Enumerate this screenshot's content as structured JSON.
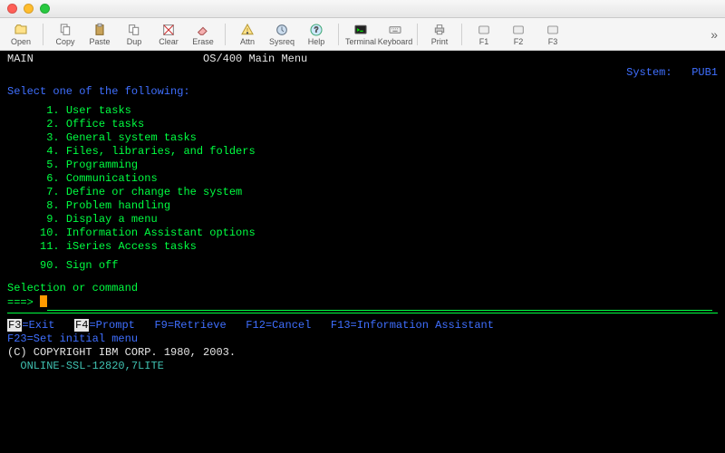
{
  "toolbar": {
    "buttons": [
      {
        "label": "Open",
        "name": "open-button",
        "icon": "open-icon"
      },
      {
        "label": "Copy",
        "name": "copy-button",
        "icon": "copy-icon"
      },
      {
        "label": "Paste",
        "name": "paste-button",
        "icon": "paste-icon"
      },
      {
        "label": "Dup",
        "name": "dup-button",
        "icon": "dup-icon"
      },
      {
        "label": "Clear",
        "name": "clear-button",
        "icon": "clear-icon"
      },
      {
        "label": "Erase",
        "name": "erase-button",
        "icon": "erase-icon"
      },
      {
        "label": "Attn",
        "name": "attn-button",
        "icon": "attn-icon"
      },
      {
        "label": "Sysreq",
        "name": "sysreq-button",
        "icon": "sysreq-icon"
      },
      {
        "label": "Help",
        "name": "help-button",
        "icon": "help-icon"
      },
      {
        "label": "Terminal",
        "name": "terminal-button",
        "icon": "terminal-icon"
      },
      {
        "label": "Keyboard",
        "name": "keyboard-button",
        "icon": "keyboard-icon"
      },
      {
        "label": "Print",
        "name": "print-button",
        "icon": "print-icon"
      },
      {
        "label": "F1",
        "name": "f1-button",
        "icon": "fkey-icon"
      },
      {
        "label": "F2",
        "name": "f2-button",
        "icon": "fkey-icon"
      },
      {
        "label": "F3",
        "name": "f3-button",
        "icon": "fkey-icon"
      }
    ],
    "overflow": "»"
  },
  "screen": {
    "menu_id": "MAIN",
    "title": "OS/400 Main Menu",
    "system_label": "System:",
    "system_name": "PUB1",
    "prompt": "Select one of the following:",
    "options": [
      {
        "num": "1.",
        "text": "User tasks"
      },
      {
        "num": "2.",
        "text": "Office tasks"
      },
      {
        "num": "3.",
        "text": "General system tasks"
      },
      {
        "num": "4.",
        "text": "Files, libraries, and folders"
      },
      {
        "num": "5.",
        "text": "Programming"
      },
      {
        "num": "6.",
        "text": "Communications"
      },
      {
        "num": "7.",
        "text": "Define or change the system"
      },
      {
        "num": "8.",
        "text": "Problem handling"
      },
      {
        "num": "9.",
        "text": "Display a menu"
      },
      {
        "num": "10.",
        "text": "Information Assistant options"
      },
      {
        "num": "11.",
        "text": "iSeries Access tasks"
      }
    ],
    "signoff": {
      "num": "90.",
      "text": "Sign off"
    },
    "cmd_label": "Selection or command",
    "cmd_prompt": "===>",
    "fkeys": [
      {
        "key": "F3",
        "label": "=Exit"
      },
      {
        "key": "F4",
        "label": "=Prompt"
      },
      {
        "key": "F9",
        "label": "=Retrieve"
      },
      {
        "key": "F12",
        "label": "=Cancel"
      },
      {
        "key": "F13",
        "label": "=Information Assistant"
      },
      {
        "key": "F23",
        "label": "=Set initial menu"
      }
    ],
    "copyright": "(C) COPYRIGHT IBM CORP. 1980, 2003.",
    "status_conn": "ONLINE-SSL-128",
    "status_pos": "20,7",
    "status_mode": "LITE"
  }
}
